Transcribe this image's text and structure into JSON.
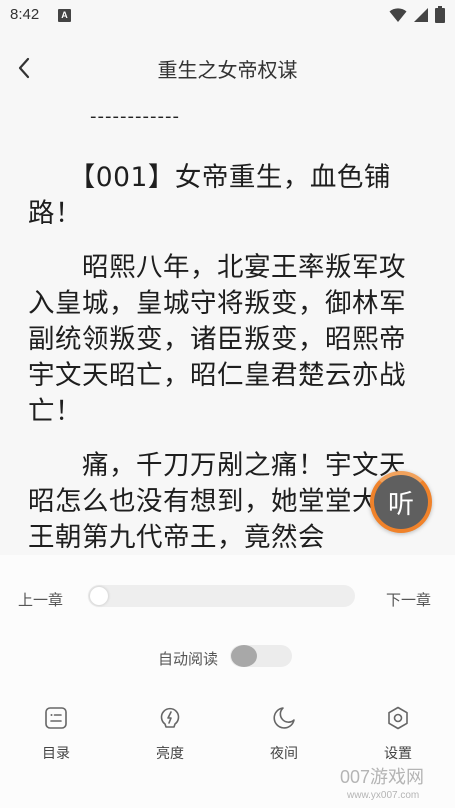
{
  "status_bar": {
    "time": "8:42",
    "notification_badge": "A",
    "icons": [
      "wifi-icon",
      "signal-icon",
      "battery-icon"
    ]
  },
  "header": {
    "title": "重生之女帝权谋"
  },
  "content": {
    "separator": "------------",
    "paragraphs": [
      "　　【001】女帝重生，血色铺路！",
      "　　昭熙八年，北宴王率叛军攻入皇城，皇城守将叛变，御林军副统领叛变，诸臣叛变，昭熙帝宇文天昭亡，昭仁皇君楚云亦战亡！",
      "　　痛，千刀万剐之痛！宇文天昭怎么也没有想到，她堂堂大宗王朝第九代帝王，竟然会"
    ]
  },
  "listen_button": {
    "label": "听"
  },
  "controls": {
    "prev_chapter": "上一章",
    "next_chapter": "下一章",
    "progress": 0.0,
    "auto_read_label": "自动阅读",
    "auto_read_on": false
  },
  "bottom_nav": [
    {
      "label": "目录",
      "icon": "catalog-icon"
    },
    {
      "label": "亮度",
      "icon": "brightness-icon"
    },
    {
      "label": "夜间",
      "icon": "moon-icon"
    },
    {
      "label": "设置",
      "icon": "settings-icon"
    }
  ],
  "watermark": {
    "text": "007游戏网",
    "url": "www.yx007.com"
  },
  "colors": {
    "accent": "#f0822a",
    "background": "#f7f7f7"
  }
}
